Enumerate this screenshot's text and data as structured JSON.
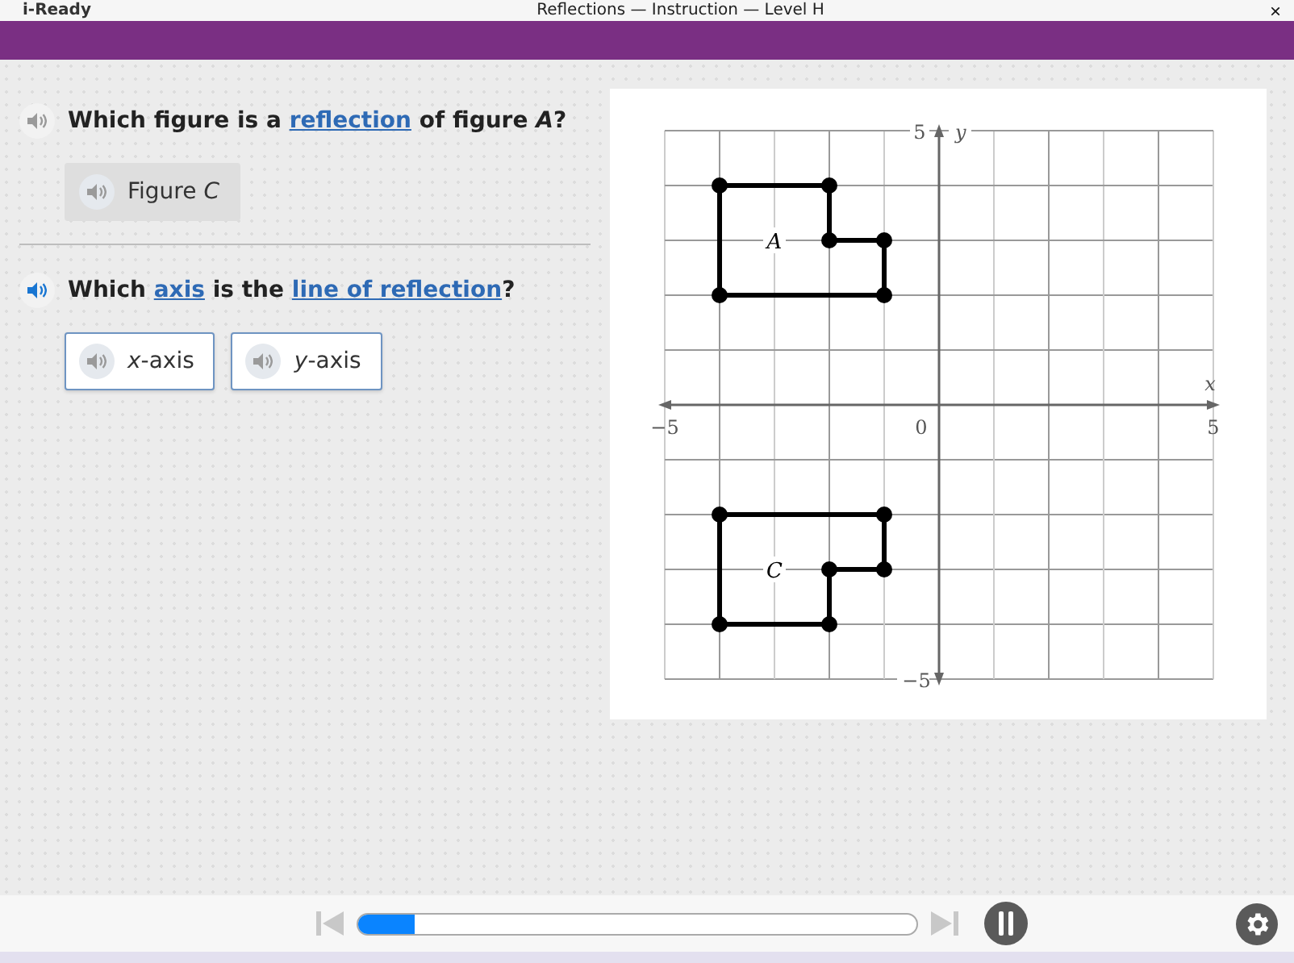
{
  "window": {
    "logo": "i-Ready",
    "title": "Reflections — Instruction — Level H",
    "close": "×"
  },
  "questions": [
    {
      "audio_active": false,
      "parts": [
        {
          "kind": "text",
          "text": "Which figure is a "
        },
        {
          "kind": "link",
          "text": "reflection"
        },
        {
          "kind": "text",
          "text": " of figure *A*?"
        }
      ],
      "answers": [
        {
          "label": "Figure *C*",
          "kind": "chosen"
        }
      ]
    },
    {
      "audio_active": true,
      "parts": [
        {
          "kind": "text",
          "text": "Which "
        },
        {
          "kind": "link",
          "text": "axis"
        },
        {
          "kind": "text",
          "text": " is the "
        },
        {
          "kind": "link",
          "text": "line of reflection"
        },
        {
          "kind": "text",
          "text": "?"
        }
      ],
      "answers": [
        {
          "label": "*x*-axis",
          "kind": "choice"
        },
        {
          "label": "*y*-axis",
          "kind": "choice"
        }
      ]
    }
  ],
  "graph": {
    "y_max": "5",
    "y_min": "−5",
    "y_label": "y",
    "x_min": "−5",
    "x_max": "5",
    "x_label": "x",
    "origin": "0",
    "figures": [
      "A",
      "C"
    ]
  },
  "player": {
    "level": 0.1
  }
}
